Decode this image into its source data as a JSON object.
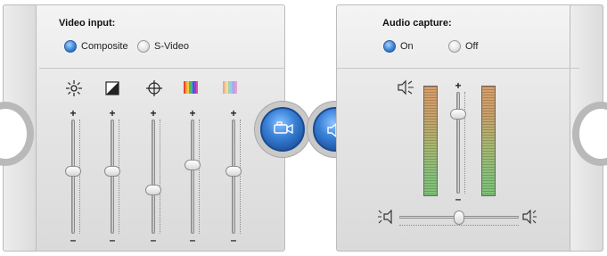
{
  "video": {
    "title": "Video input:",
    "radios": [
      {
        "label": "Composite",
        "selected": true
      },
      {
        "label": "S-Video",
        "selected": false
      }
    ],
    "sliders": [
      {
        "name": "brightness",
        "icon": "brightness-icon",
        "level": 0.55
      },
      {
        "name": "contrast",
        "icon": "contrast-icon",
        "level": 0.55
      },
      {
        "name": "hue",
        "icon": "crosshair-icon",
        "level": 0.38
      },
      {
        "name": "saturation",
        "icon": "color-bars-icon",
        "level": 0.6
      },
      {
        "name": "sharpness",
        "icon": "color-bars-faded-icon",
        "level": 0.55
      }
    ]
  },
  "audio": {
    "title": "Audio capture:",
    "radios": [
      {
        "label": "On",
        "selected": true
      },
      {
        "label": "Off",
        "selected": false
      }
    ],
    "volume_level": 0.78,
    "balance_level": 0.5
  },
  "buttons": {
    "video_icon": "camcorder-icon",
    "audio_icon": "speaker-icon"
  },
  "colors": {
    "accent": "#3a82d8",
    "panel_bg": "#e5e5e5"
  }
}
